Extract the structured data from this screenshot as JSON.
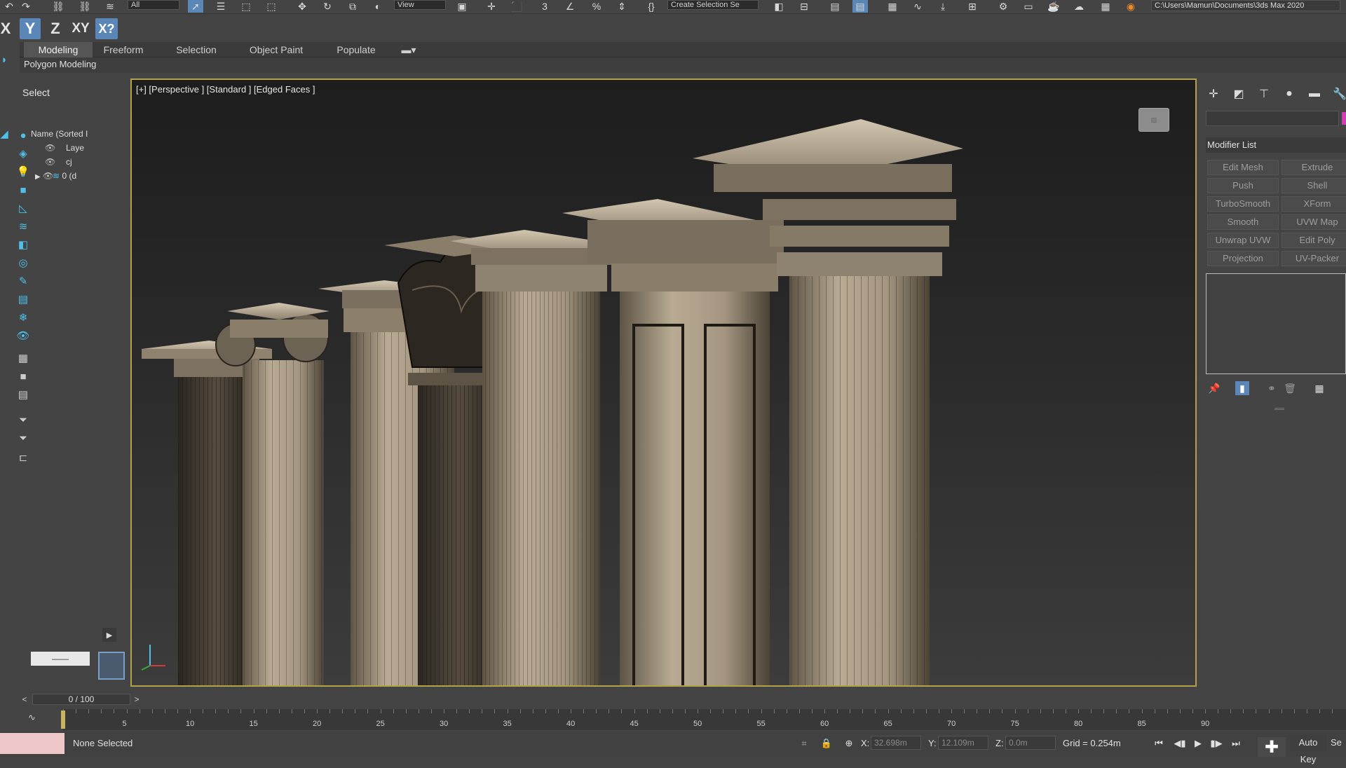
{
  "toolbar": {
    "selection_filter": "All",
    "view_combo": "View",
    "named_selection": "Create Selection Se",
    "project_path": "C:\\Users\\Mamun\\Documents\\3ds Max 2020"
  },
  "axis_constraints": {
    "x": "X",
    "y": "Y",
    "z": "Z",
    "xy": "XY",
    "xy_toggle": "X?"
  },
  "ribbon": {
    "tabs": [
      "Modeling",
      "Freeform",
      "Selection",
      "Object Paint",
      "Populate"
    ],
    "active_tab": "Modeling",
    "sub_label": "Polygon Modeling"
  },
  "scene_explorer": {
    "select_label": "Select",
    "header": "Name (Sorted I",
    "rows": [
      "Laye",
      "cj",
      "0 (d"
    ],
    "bottom_box": "——"
  },
  "viewport": {
    "label": "[+] [Perspective ] [Standard ] [Edged Faces ]"
  },
  "command_panel": {
    "modifier_list_label": "Modifier List",
    "modifiers": [
      "Edit Mesh",
      "Extrude",
      "Push",
      "Shell",
      "TurboSmooth",
      "XForm",
      "Smooth",
      "UVW Map",
      "Unwrap UVW",
      "Edit Poly",
      "Projection",
      "UV-Packer"
    ],
    "accent_color": "#cf3fb6"
  },
  "timeline": {
    "slider_text": "0 / 100",
    "ticks": [
      5,
      10,
      15,
      20,
      25,
      30,
      35,
      40,
      45,
      50,
      55,
      60,
      65,
      70,
      75,
      80,
      85,
      90
    ],
    "current_frame": 0,
    "total_frames": 100
  },
  "status": {
    "text": "None Selected",
    "x_label": "X:",
    "x_value": "32.698m",
    "y_label": "Y:",
    "y_value": "12.109m",
    "z_label": "Z:",
    "z_value": "0.0m",
    "grid": "Grid = 0.254m",
    "auto_key": "Auto Key",
    "set_key": "Se"
  },
  "colors": {
    "viewport_border": "#b4a24a",
    "active_blue": "#5b86b8",
    "column_stone": "#a89a82"
  }
}
